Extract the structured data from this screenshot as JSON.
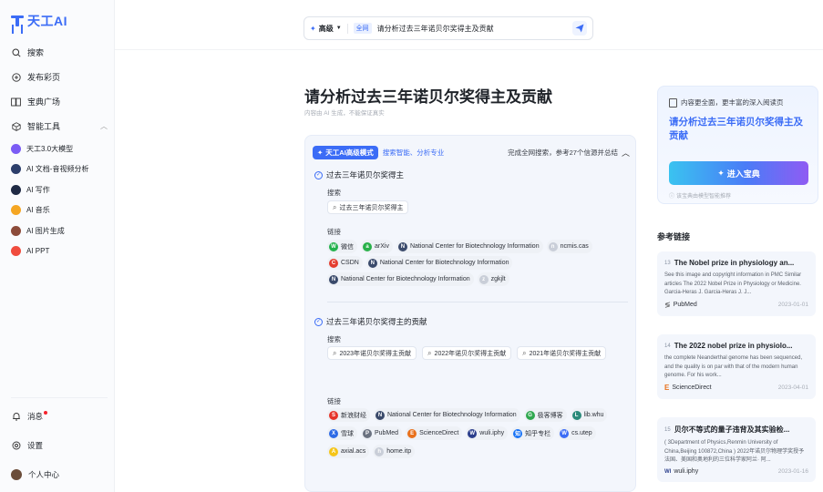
{
  "app": {
    "logo_text": "天工AI",
    "accent": "#3b6cf6"
  },
  "sidebar": {
    "items": [
      {
        "label": "搜索",
        "icon": "search-icon"
      },
      {
        "label": "发布彩页",
        "icon": "plus-circle-icon"
      },
      {
        "label": "宝典广场",
        "icon": "book-icon"
      },
      {
        "label": "智能工具",
        "icon": "cube-icon"
      }
    ],
    "tools": [
      {
        "label": "天工3.0大模型",
        "color": "#7b5cf5"
      },
      {
        "label": "AI 文档-音视频分析",
        "color": "#2c3e6b"
      },
      {
        "label": "AI 写作",
        "color": "#1f2a44"
      },
      {
        "label": "AI 音乐",
        "color": "#f5a623"
      },
      {
        "label": "AI 图片生成",
        "color": "#8c4b3a"
      },
      {
        "label": "AI PPT",
        "color": "#f04c3e"
      }
    ],
    "bottom": [
      {
        "label": "消息",
        "icon": "bell-icon"
      },
      {
        "label": "设置",
        "icon": "settings-icon"
      },
      {
        "label": "个人中心",
        "icon": "avatar-icon"
      }
    ]
  },
  "search": {
    "mode": "高级",
    "scope": "全网",
    "query": "请分析过去三年诺贝尔奖得主及贡献"
  },
  "main": {
    "title": "请分析过去三年诺贝尔奖得主及贡献",
    "disclaimer": "内容由 AI 生成，不能保证真实",
    "panel": {
      "badge": "天工AI高级模式",
      "badge_sub": "搜索智能、分析专业",
      "status": "完成全网搜索，参考27个信源并总结",
      "steps": [
        {
          "title": "过去三年诺贝尔奖得主",
          "search_label": "搜索",
          "queries": [
            "过去三年诺贝尔奖得主"
          ],
          "link_label": "链接",
          "links": [
            {
              "name": "微信",
              "color": "#22b14c",
              "glyph": "W"
            },
            {
              "name": "arXiv",
              "color": "#29b14a",
              "glyph": "a"
            },
            {
              "name": "National Center for Biotechnology Information",
              "color": "#3a4a6b",
              "glyph": "N"
            },
            {
              "name": "ncmis.cas",
              "color": "#c9ced8",
              "glyph": "n"
            },
            {
              "name": "CSDN",
              "color": "#e43d2f",
              "glyph": "C"
            },
            {
              "name": "National Center for Biotechnology Information",
              "color": "#3a4a6b",
              "glyph": "N"
            },
            {
              "name": "National Center for Biotechnology Information",
              "color": "#3a4a6b",
              "glyph": "N"
            },
            {
              "name": "zgkjlt",
              "color": "#c9ced8",
              "glyph": "z"
            }
          ]
        },
        {
          "title": "过去三年诺贝尔奖得主的贡献",
          "search_label": "搜索",
          "queries": [
            "2023年诺贝尔奖得主贡献",
            "2022年诺贝尔奖得主贡献",
            "2021年诺贝尔奖得主贡献"
          ],
          "link_label": "链接",
          "links": [
            {
              "name": "新浪财经",
              "color": "#e6342a",
              "glyph": "S"
            },
            {
              "name": "National Center for Biotechnology Information",
              "color": "#3a4a6b",
              "glyph": "N"
            },
            {
              "name": "极客博客",
              "color": "#2fa84f",
              "glyph": "G"
            },
            {
              "name": "lib.whu",
              "color": "#2a8a7a",
              "glyph": "L"
            },
            {
              "name": "雪球",
              "color": "#2e6be6",
              "glyph": "X"
            },
            {
              "name": "PubMed",
              "color": "#6b7280",
              "glyph": "P"
            },
            {
              "name": "ScienceDirect",
              "color": "#e9711c",
              "glyph": "E"
            },
            {
              "name": "wuli.iphy",
              "color": "#2b3e8c",
              "glyph": "W"
            },
            {
              "name": "知乎专栏",
              "color": "#1772f6",
              "glyph": "知"
            },
            {
              "name": "cs.utep",
              "color": "#3b6cf6",
              "glyph": "W"
            },
            {
              "name": "axial.acs",
              "color": "#f5c518",
              "glyph": "A"
            },
            {
              "name": "home.itp",
              "color": "#c9ced8",
              "glyph": "h"
            }
          ]
        }
      ]
    }
  },
  "right": {
    "promo": {
      "top_text": "内容更全面，更丰富的深入阅读页",
      "title": "请分析过去三年诺贝尔奖得主及贡献",
      "button": "进入宝典",
      "note": "该宝典由模型智能推荐"
    },
    "refs_title": "参考链接",
    "refs": [
      {
        "num": "13",
        "title": "The Nobel prize in physiology an...",
        "snippet": "See this image and copyright information in PMC Similar articles The 2022 Nobel Prize in Physiology or Medicine. Garcia-Heras J. Garcia-Heras J. J...",
        "source": "PubMed",
        "date": "2023-01-01"
      },
      {
        "num": "14",
        "title": "The 2022 nobel prize in physiolo...",
        "snippet": "the complete Neanderthal genome has been sequenced, and the quality is on par with that of the modern human genome. For his work...",
        "source": "ScienceDirect",
        "date": "2023-04-01"
      },
      {
        "num": "15",
        "title": "贝尔不等式的量子违背及其实验检...",
        "snippet": "( 3Department of Physics,Renmin University of China,Beijing 100872,China ) 2022年诺贝尔物理学奖授予法国、美国和奥地利的三位科学家阿兰· 阿...",
        "source": "wuli.iphy",
        "date": "2023-01-16"
      }
    ]
  }
}
